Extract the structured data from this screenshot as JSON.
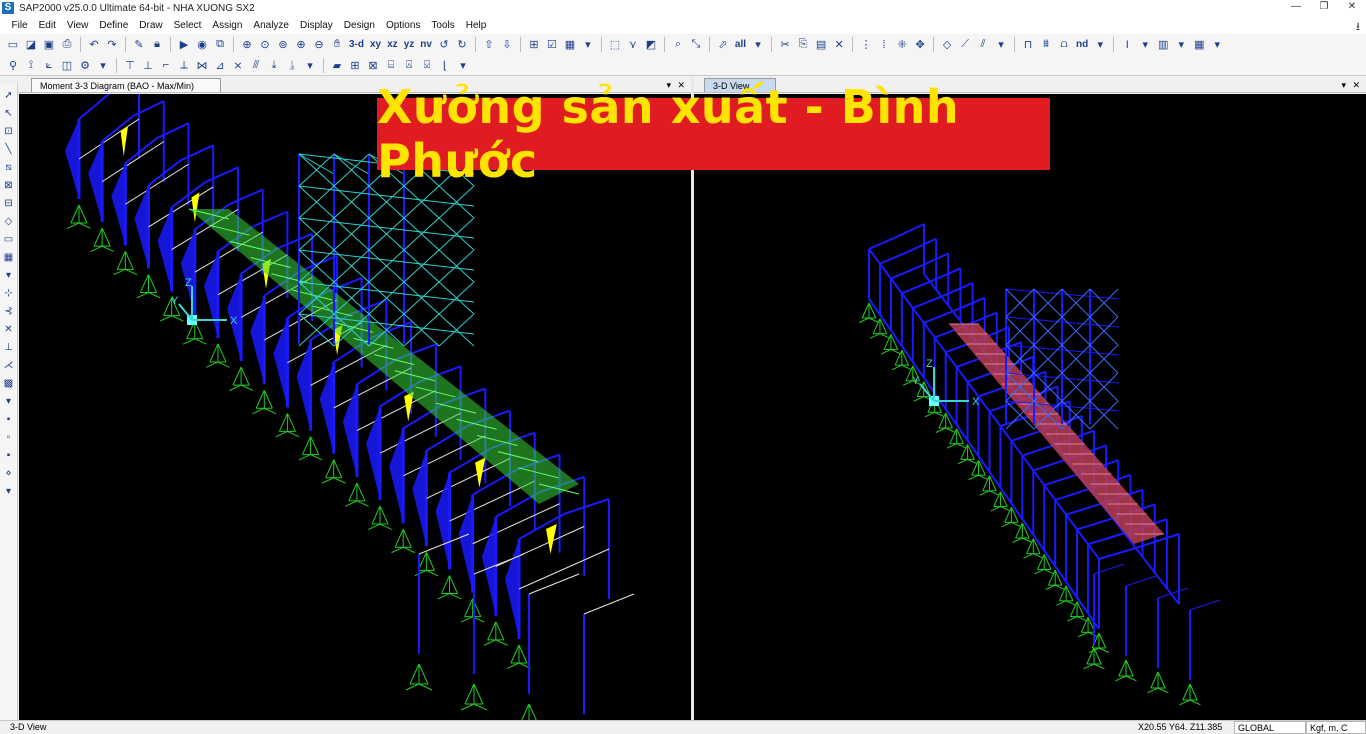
{
  "window": {
    "title": "SAP2000 v25.0.0 Ultimate 64-bit - NHA XUONG SX2",
    "app_icon_letter": "S",
    "minimize": "—",
    "maximize": "❐",
    "close": "✕"
  },
  "menu": [
    "File",
    "Edit",
    "View",
    "Define",
    "Draw",
    "Select",
    "Assign",
    "Analyze",
    "Display",
    "Design",
    "Options",
    "Tools",
    "Help"
  ],
  "toolbar1": {
    "view_3d": "3-d",
    "view_xy": "xy",
    "view_xz": "xz",
    "view_yz": "yz",
    "view_nv": "nv",
    "select_all": "all",
    "nd": "nd"
  },
  "panels": {
    "left_title": "Moment 3-3 Diagram (BAO - Max/Min)",
    "right_title": "3-D View",
    "dropdown_glyph": "▾",
    "close_glyph": "✕"
  },
  "axes": {
    "x": "X",
    "y": "Y",
    "z": "Z"
  },
  "banner_text": "Xưởng sản xuất - Bình Phước",
  "status": {
    "view_label": "3-D View",
    "coords": "X20.55  Y64.  Z11.385",
    "coord_system": "GLOBAL",
    "units": "Kgf, m, C"
  },
  "colors": {
    "frame_blue": "#1a1aff",
    "support_green": "#22cc22",
    "cross_bracing_cyan": "#2fd0d0",
    "section_white": "#e6e6e6",
    "slab_green": "#39d639",
    "selected_red": "#b83d55",
    "moment_yellow": "#ffff00",
    "banner_red": "#e11b22",
    "banner_text_yellow": "#ffe400"
  }
}
